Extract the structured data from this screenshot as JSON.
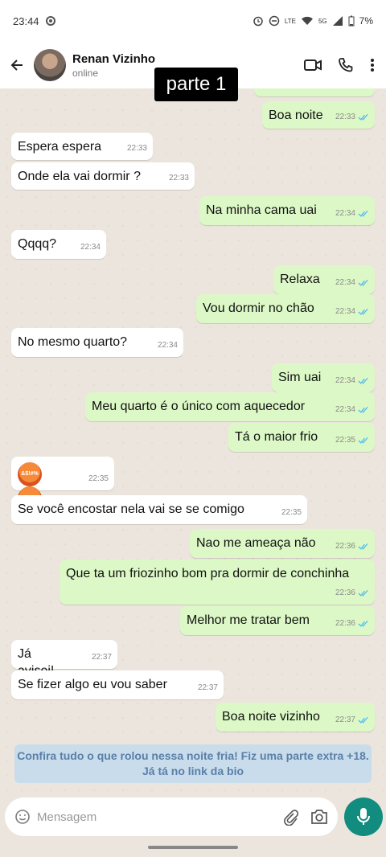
{
  "status_bar": {
    "time": "23:44",
    "network": "LTE",
    "network2": "5G",
    "battery": "7%"
  },
  "header": {
    "contact_name": "Renan Vizinho",
    "contact_status": "online"
  },
  "overlay": {
    "label": "parte 1"
  },
  "messages": [
    {
      "dir": "out",
      "text": "Boa noite",
      "time": "22:33"
    },
    {
      "dir": "in",
      "text": "Espera espera",
      "time": "22:33"
    },
    {
      "dir": "in",
      "text": "Onde ela vai dormir ?",
      "time": "22:33"
    },
    {
      "dir": "out",
      "text": "Na minha cama uai",
      "time": "22:34"
    },
    {
      "dir": "in",
      "text": "Qqqq?",
      "time": "22:34"
    },
    {
      "dir": "out",
      "text": "Relaxa",
      "time": "22:34"
    },
    {
      "dir": "out",
      "text": "Vou dormir no chão",
      "time": "22:34"
    },
    {
      "dir": "in",
      "text": "No mesmo quarto?",
      "time": "22:34"
    },
    {
      "dir": "out",
      "text": "Sim uai",
      "time": "22:34"
    },
    {
      "dir": "out",
      "text": "Meu quarto é o único com aquecedor",
      "time": "22:34"
    },
    {
      "dir": "out",
      "text": "Tá o maior frio",
      "time": "22:35"
    },
    {
      "dir": "in",
      "text": "",
      "emoji": [
        "angry-face-icon",
        "angry-face-icon"
      ],
      "time": "22:35"
    },
    {
      "dir": "in",
      "text": "Se você encostar nela vai se se comigo",
      "time": "22:35"
    },
    {
      "dir": "out",
      "text": "Nao me ameaça não",
      "time": "22:36"
    },
    {
      "dir": "out",
      "text": "Que ta um friozinho bom pra dormir de conchinha",
      "time": "22:36"
    },
    {
      "dir": "out",
      "text": "Melhor me tratar bem",
      "time": "22:36"
    },
    {
      "dir": "in",
      "text": "Já avisei!",
      "time": "22:37"
    },
    {
      "dir": "in",
      "text": "Se fizer algo eu vou saber",
      "time": "22:37"
    },
    {
      "dir": "out",
      "text": "Boa noite vizinho",
      "time": "22:37"
    }
  ],
  "banner": {
    "text": "Confira tudo o que rolou nessa noite fria! Fiz uma parte extra +18. Já tá no link da bio"
  },
  "input": {
    "placeholder": "Mensagem"
  },
  "colors": {
    "accent": "#128c7e",
    "read_ticks": "#53bdeb",
    "outgoing_bubble": "#dcf8c6"
  },
  "icons": [
    "back-arrow-icon",
    "video-call-icon",
    "phone-icon",
    "more-options-icon",
    "emoji-icon",
    "attach-icon",
    "camera-icon",
    "mic-icon"
  ]
}
